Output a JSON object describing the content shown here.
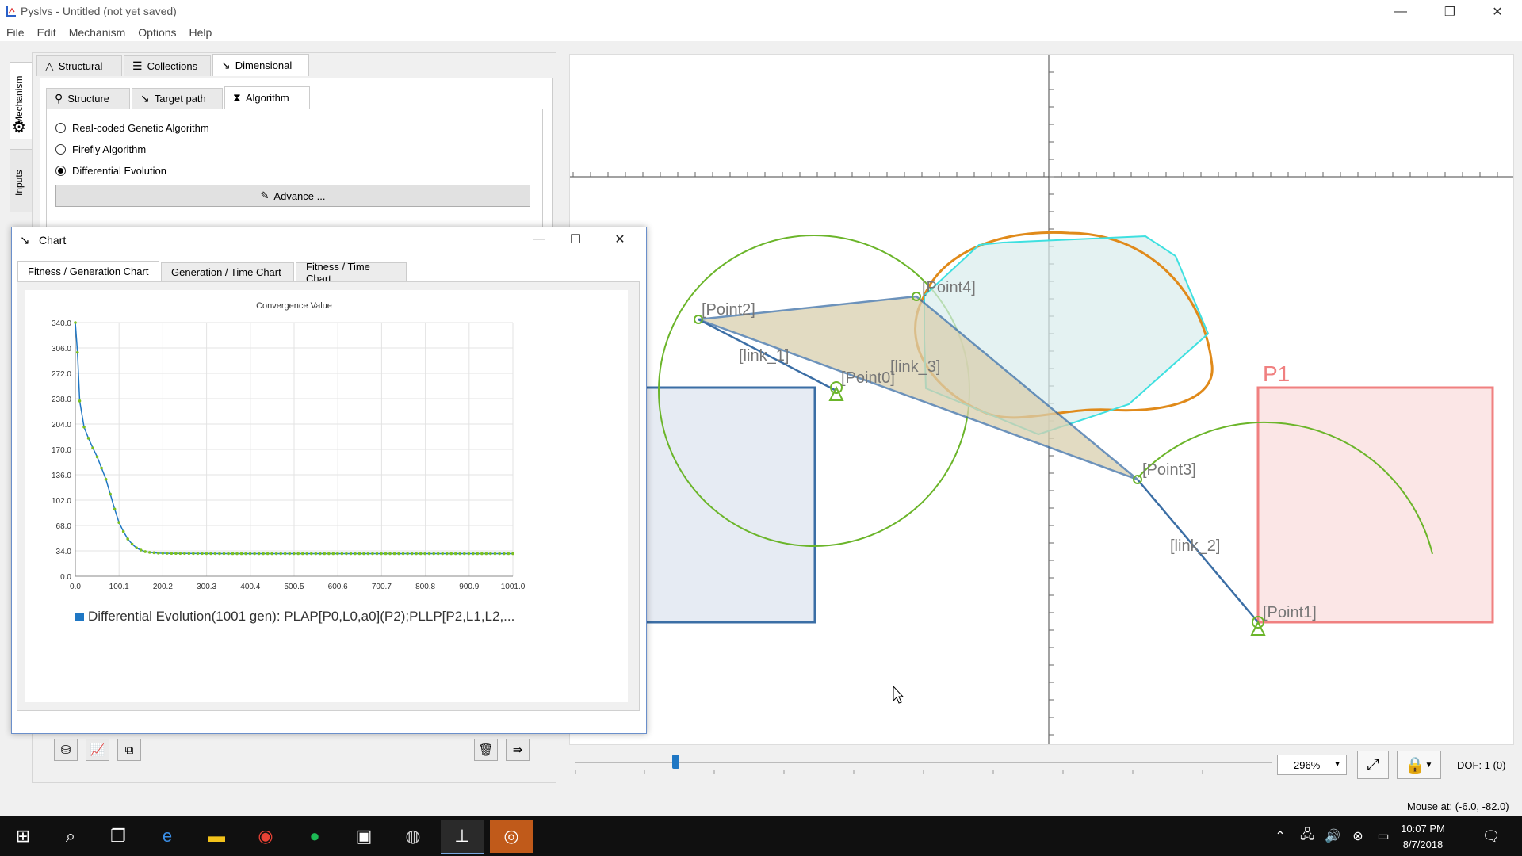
{
  "window": {
    "title": "Pyslvs - Untitled (not yet saved)",
    "minimize": "—",
    "restore": "❐",
    "close": "✕"
  },
  "menu": [
    "File",
    "Edit",
    "Mechanism",
    "Options",
    "Help"
  ],
  "side_tabs": [
    "Mechanism",
    "Inputs"
  ],
  "main_tabs": [
    {
      "label": "Structural",
      "icon": "structural-icon"
    },
    {
      "label": "Collections",
      "icon": "collections-icon"
    },
    {
      "label": "Dimensional",
      "icon": "dimensional-icon",
      "active": true
    }
  ],
  "sub_tabs": [
    {
      "label": "Structure",
      "icon": "structure-icon"
    },
    {
      "label": "Target path",
      "icon": "target-path-icon"
    },
    {
      "label": "Algorithm",
      "icon": "algorithm-icon",
      "active": true
    }
  ],
  "algorithms": [
    {
      "label": "Real-coded Genetic Algorithm",
      "selected": false
    },
    {
      "label": "Firefly Algorithm",
      "selected": false
    },
    {
      "label": "Differential Evolution",
      "selected": true
    }
  ],
  "advance_button": "Advance ...",
  "chart_window": {
    "title": "Chart",
    "tabs": [
      "Fitness / Generation Chart",
      "Generation / Time Chart",
      "Fitness / Time Chart"
    ],
    "active_tab": 0
  },
  "chart_data": {
    "type": "line",
    "title": "Convergence Value",
    "xlabel": "",
    "ylabel": "",
    "xlim": [
      0.0,
      1001.0
    ],
    "ylim": [
      0.0,
      340.0
    ],
    "x_ticks": [
      "0.0",
      "100.1",
      "200.2",
      "300.3",
      "400.4",
      "500.5",
      "600.6",
      "700.7",
      "800.8",
      "900.9",
      "1001.0"
    ],
    "y_ticks": [
      "0.0",
      "34.0",
      "68.0",
      "102.0",
      "136.0",
      "170.0",
      "204.0",
      "238.0",
      "272.0",
      "306.0",
      "340.0"
    ],
    "grid": true,
    "legend_position": "bottom",
    "series": [
      {
        "name": "Differential Evolution(1001 gen): PLAP[P0,L0,a0](P2);PLLP[P2,L1,L2,...",
        "line_color": "#1f77c4",
        "point_color": "#7cc021",
        "x": [
          0,
          5,
          10,
          20,
          30,
          40,
          50,
          60,
          70,
          80,
          90,
          100,
          110,
          120,
          130,
          140,
          150,
          160,
          170,
          180,
          190,
          200,
          220,
          250,
          300,
          350,
          400,
          450,
          500,
          550,
          600,
          650,
          700,
          750,
          800,
          850,
          900,
          950,
          1001
        ],
        "y": [
          340,
          300,
          235,
          200,
          185,
          172,
          160,
          145,
          130,
          110,
          90,
          72,
          60,
          50,
          43,
          38,
          35,
          33,
          32,
          31.5,
          31,
          30.8,
          30.6,
          30.5,
          30.4,
          30.3,
          30.3,
          30.3,
          30.3,
          30.3,
          30.3,
          30.3,
          30.3,
          30.3,
          30.3,
          30.3,
          30.3,
          30.3,
          30.3
        ]
      }
    ]
  },
  "canvas": {
    "labels": [
      "[Point0]",
      "[Point1]",
      "[Point2]",
      "[Point3]",
      "[Point4]",
      "[link_1]",
      "[link_2]",
      "[link_3]",
      "P1"
    ]
  },
  "zoom": "296%",
  "dof": "DOF:  1 (0)",
  "mouse_at": "Mouse at: (-6.0, -82.0)",
  "clock": {
    "time": "10:07 PM",
    "date": "8/7/2018"
  },
  "colors": {
    "link_blue": "#3b6ea5",
    "circle_green": "#6bb52a",
    "path_orange": "#e08a1a",
    "path_cyan": "#3ee0e0",
    "target_red": "#f08080"
  }
}
